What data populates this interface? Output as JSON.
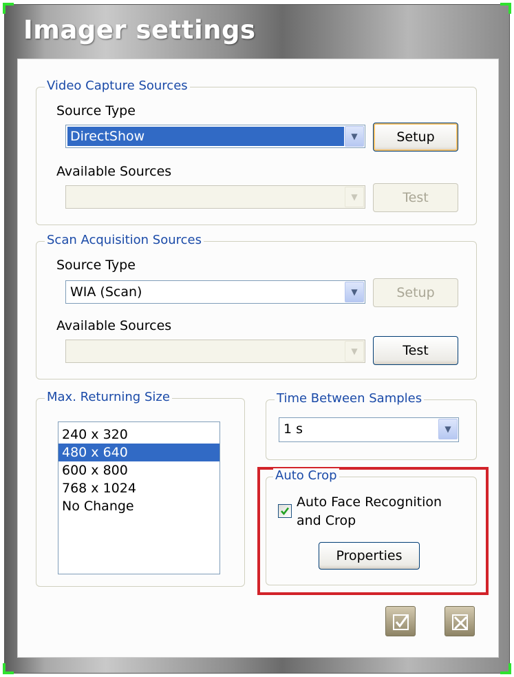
{
  "window": {
    "title": "Imager settings"
  },
  "video_capture": {
    "legend": "Video Capture Sources",
    "source_type_label": "Source Type",
    "source_type_value": "DirectShow",
    "setup_label": "Setup",
    "available_sources_label": "Available Sources",
    "available_sources_value": "",
    "test_label": "Test"
  },
  "scan_acquisition": {
    "legend": "Scan Acquisition Sources",
    "source_type_label": "Source Type",
    "source_type_value": "WIA (Scan)",
    "setup_label": "Setup",
    "available_sources_label": "Available Sources",
    "available_sources_value": "",
    "test_label": "Test"
  },
  "max_returning_size": {
    "legend": "Max. Returning Size",
    "options": [
      "240 x 320",
      "480 x 640",
      "600 x 800",
      "768 x 1024",
      "No Change"
    ],
    "selected": "480 x 640"
  },
  "time_between_samples": {
    "legend": "Time Between Samples",
    "value": "1 s"
  },
  "auto_crop": {
    "legend": "Auto Crop",
    "checkbox_label_line1": "Auto Face Recognition",
    "checkbox_label_line2": "and Crop",
    "checked": true,
    "properties_label": "Properties"
  },
  "footer": {
    "ok_icon": "checkbox-check-icon",
    "cancel_icon": "checkbox-cross-icon"
  },
  "colors": {
    "legend_text": "#1a4aa8",
    "selection": "#316ac5",
    "highlight_border": "#d2232a",
    "corner_marker": "#2fe22f"
  }
}
